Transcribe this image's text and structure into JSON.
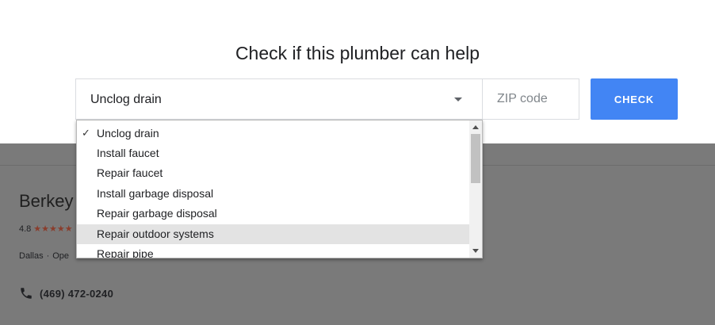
{
  "title": "Check if this plumber can help",
  "service_select": {
    "value": "Unclog drain",
    "options": [
      "Unclog drain",
      "Install faucet",
      "Repair faucet",
      "Install garbage disposal",
      "Repair garbage disposal",
      "Repair outdoor systems",
      "Repair pipe"
    ],
    "selected_index": 0,
    "highlighted_index": 5
  },
  "zip": {
    "value": "",
    "placeholder": "ZIP code"
  },
  "check_button": "CHECK",
  "business": {
    "name": "Berkey",
    "rating": "4.8",
    "stars": "★★★★★",
    "location": "Dallas",
    "separator": "·",
    "status": "Ope",
    "phone": "(469) 472-0240"
  },
  "icons": {
    "check": "checkmark-icon",
    "caret": "chevron-down-icon",
    "phone": "phone-icon"
  },
  "colors": {
    "accent": "#4285f4",
    "overlay": "#7a7a7a",
    "highlight": "#e3e3e3"
  }
}
